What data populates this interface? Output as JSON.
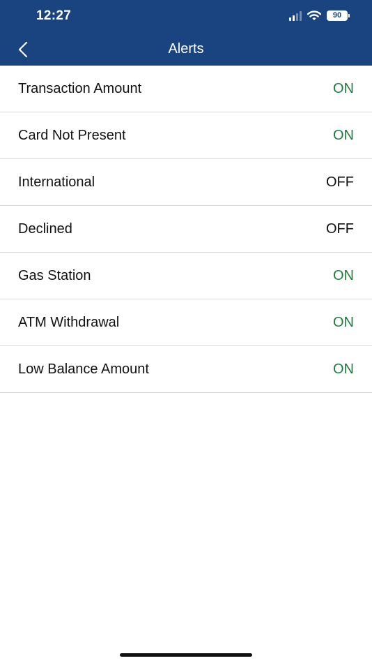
{
  "status_bar": {
    "time": "12:27",
    "battery": "90",
    "icons": [
      "signal-icon",
      "wifi-icon",
      "battery-icon"
    ]
  },
  "header": {
    "title": "Alerts",
    "back_icon": "chevron-left-icon",
    "background_color": "#1a4480"
  },
  "alerts": [
    {
      "label": "Transaction Amount",
      "status": "ON"
    },
    {
      "label": "Card Not Present",
      "status": "ON"
    },
    {
      "label": "International",
      "status": "OFF"
    },
    {
      "label": "Declined",
      "status": "OFF"
    },
    {
      "label": "Gas Station",
      "status": "ON"
    },
    {
      "label": "ATM Withdrawal",
      "status": "ON"
    },
    {
      "label": "Low Balance Amount",
      "status": "ON"
    }
  ],
  "colors": {
    "on": "#1e7d3e",
    "off": "#111111"
  }
}
